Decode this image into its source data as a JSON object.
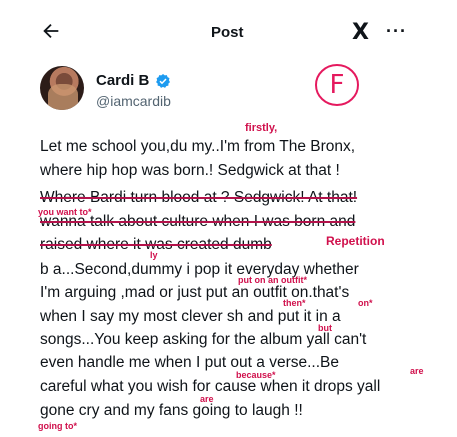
{
  "header": {
    "title": "Post",
    "back_icon": "arrow-left-icon",
    "logo_text": "X",
    "more_label": "···"
  },
  "author": {
    "name": "Cardi B",
    "handle": "@iamcardib",
    "verified_color": "#1d9bf0"
  },
  "annotation_mark": "F",
  "accent_color": "#e5195e",
  "tweet_lines": [
    "Let me school you,du  my..I'm from The Bronx,",
    "where hip hop was born.! Sedgwick at that !",
    "Where Bardi turn blood at ? Sedgwick! At that!",
    "wanna talk about culture when I was born and",
    "raised where it was created dumb",
    "b   a...Second,dummy i pop it everyday whether",
    "I'm arguing ,mad or just put an outfit on.that's",
    "when I say my most clever sh   and put it in a",
    "songs...You keep asking for the album yall can't",
    "even handle me when I put out a verse...Be",
    "careful what you wish for cause when it drops yall",
    "gone cry and my fans going to laugh !!"
  ],
  "annotations": {
    "firstly": "firstly,",
    "you_want_to": "you want to*",
    "repetition": "Repetition",
    "ly": "ly",
    "put_on_an_outfit": "put on an outfit*",
    "then": "then*",
    "on": "on*",
    "but": "but",
    "are1": "are",
    "because": "because*",
    "are2": "are",
    "going_to": "going to*"
  }
}
